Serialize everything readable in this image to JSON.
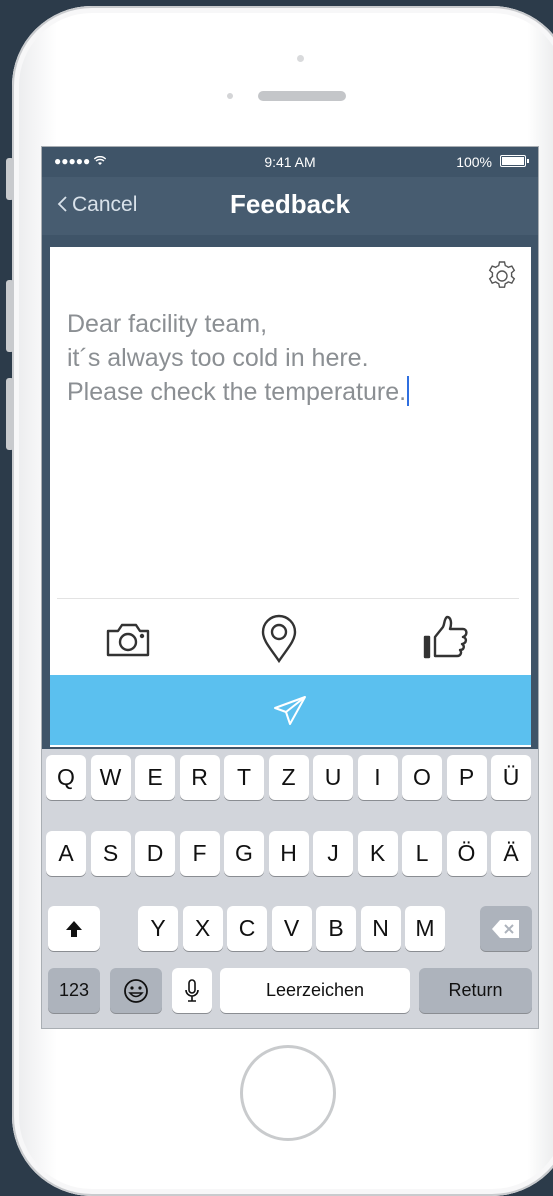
{
  "status_bar": {
    "signal": "●●●●● ",
    "time": "9:41 AM",
    "battery": "100%"
  },
  "nav": {
    "cancel": "Cancel",
    "title": "Feedback"
  },
  "message": {
    "lines": [
      "Dear facility team,",
      "it´s always too cold in here.",
      "Please check the temperature."
    ]
  },
  "actions": [
    "camera-icon",
    "location-pin-icon",
    "thumbs-up-icon"
  ],
  "icons": {
    "settings": "gear-icon",
    "send": "paper-plane-icon",
    "shift": "shift-arrow-icon",
    "delete": "backspace-icon",
    "emoji": "emoji-icon",
    "mic": "microphone-icon",
    "wifi": "wifi-icon"
  },
  "keyboard": {
    "row1": [
      "Q",
      "W",
      "E",
      "R",
      "T",
      "Z",
      "U",
      "I",
      "O",
      "P",
      "Ü"
    ],
    "row2": [
      "A",
      "S",
      "D",
      "F",
      "G",
      "H",
      "J",
      "K",
      "L",
      "Ö",
      "Ä"
    ],
    "row3": [
      "Y",
      "X",
      "C",
      "V",
      "B",
      "N",
      "M"
    ],
    "numbers": "123",
    "space": "Leerzeichen",
    "return": "Return"
  },
  "colors": {
    "navbar": "#475c70",
    "send_button": "#5bc0ef",
    "background": "#2c3b4a",
    "caret": "#2f6fe0"
  }
}
